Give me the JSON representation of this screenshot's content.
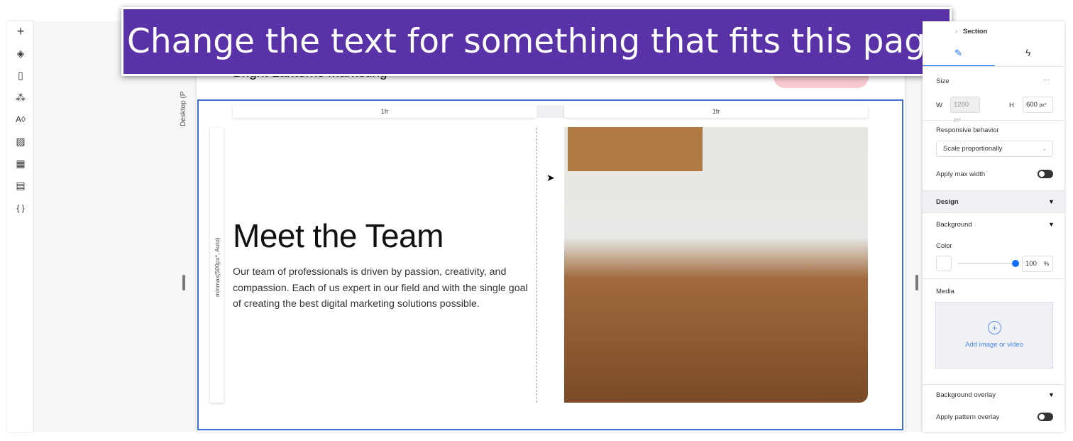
{
  "banner": {
    "text": "Change the text for something that fits this page"
  },
  "toolbar": {
    "items": [
      {
        "name": "add",
        "glyph": "+"
      },
      {
        "name": "layers",
        "glyph": "◈"
      },
      {
        "name": "pages",
        "glyph": "▯"
      },
      {
        "name": "apps",
        "glyph": "⁂"
      },
      {
        "name": "theme",
        "glyph": "A◊"
      },
      {
        "name": "media",
        "glyph": "▨"
      },
      {
        "name": "widgets",
        "glyph": "▦"
      },
      {
        "name": "table",
        "glyph": "▤"
      },
      {
        "name": "code",
        "glyph": "{ }"
      }
    ]
  },
  "canvas": {
    "breakpoint_label": "Desktop (P",
    "site_name": "Bright Lanterns Marketing",
    "columns": [
      "1fr",
      "1fr"
    ],
    "row_label": "minmax(500px*, Auto)",
    "heading": "Meet the Team",
    "body": "Our team of professionals is driven by passion, creativity, and compassion. Each of us expert in our field and with the single goal of creating the best digital marketing solutions possible."
  },
  "panel": {
    "breadcrumb": "Section",
    "size_label": "Size",
    "more": "···",
    "w_label": "W",
    "w_value": "1280",
    "w_unit": "px*",
    "h_label": "H",
    "h_value": "600",
    "h_unit": "px*",
    "responsive_label": "Responsive behavior",
    "responsive_value": "Scale proportionally",
    "max_width_label": "Apply max width",
    "max_width_on": false,
    "design_label": "Design",
    "background_label": "Background",
    "color_label": "Color",
    "color_value": "#ffffff",
    "opacity": "100",
    "opacity_unit": "%",
    "opacity_fraction": 1.0,
    "media_label": "Media",
    "add_media": "Add image or video",
    "overlay_label": "Background overlay",
    "pattern_label": "Apply pattern overlay",
    "pattern_on": false,
    "accent": "#116dff"
  }
}
